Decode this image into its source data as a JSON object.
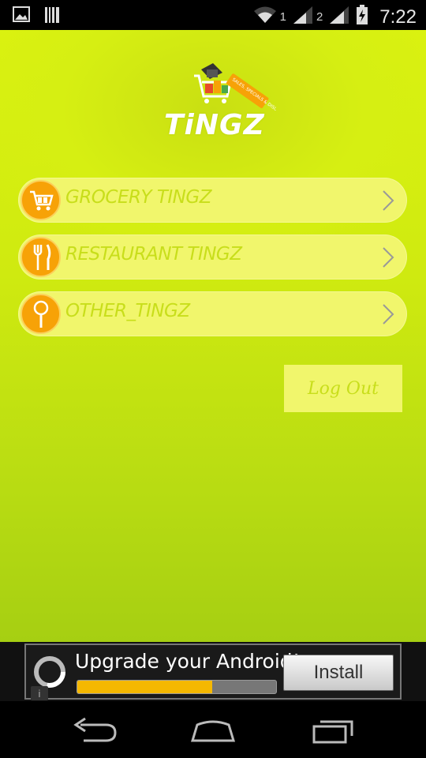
{
  "status_bar": {
    "time": "7:22",
    "sim1": "1",
    "sim2": "2",
    "icons": [
      "image-icon",
      "barcode-icon",
      "wifi-icon",
      "signal-icon",
      "signal-icon",
      "battery-charging-icon"
    ]
  },
  "app": {
    "logo_text": "TiNGZ",
    "logo_tag": "SALES, SPECIALS & DISCOUNT ALERTS",
    "menu": [
      {
        "label": "GROCERY TINGZ",
        "icon": "shopping-cart-icon"
      },
      {
        "label": "RESTAURANT TINGZ",
        "icon": "fork-knife-icon"
      },
      {
        "label": "OTHER_TINGZ",
        "icon": "magnifier-icon"
      }
    ],
    "logout_label": "Log Out"
  },
  "ad": {
    "title": "Upgrade your Android!",
    "install_label": "Install",
    "info": "i",
    "progress": 0.68
  },
  "colors": {
    "background": "#d6ef12",
    "menu_bg": "#f1f66c",
    "menu_text": "#c8de1a",
    "icon_orange": "#f7a207"
  }
}
